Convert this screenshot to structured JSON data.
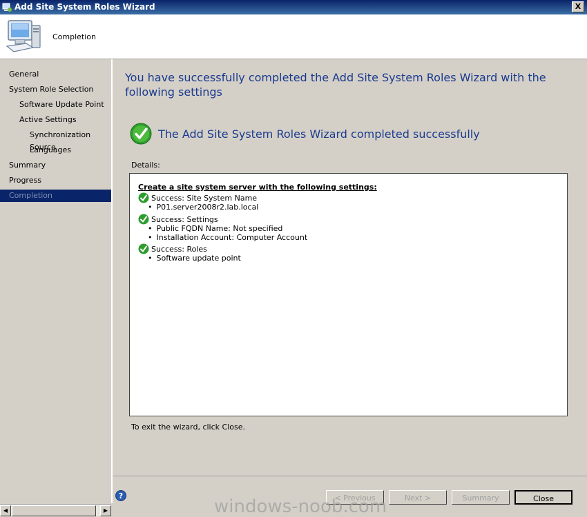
{
  "window": {
    "title": "Add Site System Roles Wizard",
    "close_glyph": "X"
  },
  "header": {
    "page_title": "Completion",
    "icon": "computer-icon"
  },
  "sidebar": {
    "items": [
      {
        "label": "General"
      },
      {
        "label": "System Role Selection"
      },
      {
        "label": "Software Update Point"
      },
      {
        "label": "Active Settings"
      },
      {
        "label": "Synchronization Source"
      },
      {
        "label": "Languages"
      },
      {
        "label": "Summary"
      },
      {
        "label": "Progress"
      },
      {
        "label": "Completion",
        "selected": true
      }
    ]
  },
  "main": {
    "heading": "You have successfully completed the Add Site System Roles Wizard with the following settings",
    "success_message": "The Add Site System Roles Wizard completed successfully",
    "details_label": "Details:",
    "details": {
      "header": "Create a site system server with the following settings:",
      "groups": [
        {
          "title": "Success: Site System Name",
          "items": [
            "P01.server2008r2.lab.local"
          ]
        },
        {
          "title": "Success: Settings",
          "items": [
            "Public FQDN Name: Not specified",
            "Installation Account: Computer Account"
          ]
        },
        {
          "title": "Success: Roles",
          "items": [
            "Software update point"
          ]
        }
      ]
    },
    "exit_text": "To exit the wizard, click Close."
  },
  "footer": {
    "previous": "< Previous",
    "next": "Next >",
    "summary": "Summary",
    "close": "Close"
  },
  "watermark": "windows-noob.com",
  "colors": {
    "accent": "#1a3a8e",
    "selection": "#0a246a",
    "success": "#2e9c2e"
  }
}
